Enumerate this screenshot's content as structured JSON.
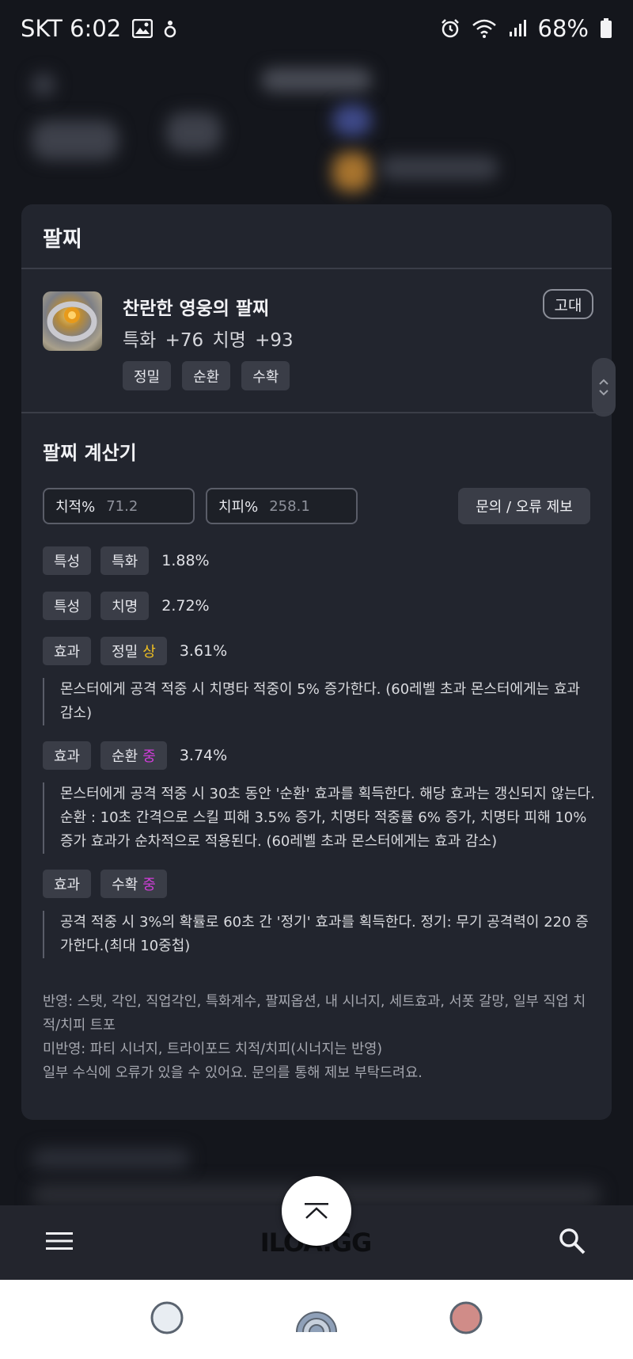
{
  "status_bar": {
    "carrier_time": "SKT 6:02",
    "battery": "68%"
  },
  "card": {
    "section_title": "팔찌",
    "item": {
      "name": "찬란한 영웅의 팔찌",
      "stats": "특화 +76  치명 +93",
      "grade": "고대",
      "chips": [
        "정밀",
        "순환",
        "수확"
      ]
    },
    "calculator": {
      "title": "팔찌 계산기",
      "crit_rate_label": "치적%",
      "crit_rate_value": "71.2",
      "crit_dmg_label": "치피%",
      "crit_dmg_value": "258.1",
      "report_button": "문의 / 오류 제보",
      "rows": [
        {
          "type": "특성",
          "name": "특화",
          "grade": "",
          "value": "1.88%"
        },
        {
          "type": "특성",
          "name": "치명",
          "grade": "",
          "value": "2.72%"
        },
        {
          "type": "효과",
          "name": "정밀",
          "grade": "상",
          "value": "3.61%",
          "desc": "몬스터에게 공격 적중 시 치명타 적중이 5% 증가한다. (60레벨 초과 몬스터에게는 효과 감소)"
        },
        {
          "type": "효과",
          "name": "순환",
          "grade": "중",
          "value": "3.74%",
          "desc": "몬스터에게 공격 적중 시 30초 동안 '순환' 효과를 획득한다. 해당 효과는 갱신되지 않는다. 순환 : 10초 간격으로 스킬 피해 3.5% 증가, 치명타 적중률 6% 증가, 치명타 피해 10% 증가 효과가 순차적으로 적용된다. (60레벨 초과 몬스터에게는 효과 감소)"
        },
        {
          "type": "효과",
          "name": "수확",
          "grade": "중",
          "value": "",
          "desc": "공격 적중 시 3%의 확률로 60초 간 '정기' 효과를 획득한다. 정기: 무기 공격력이 220 증가한다.(최대 10중첩)"
        }
      ],
      "notes": [
        "반영: 스탯, 각인, 직업각인, 특화계수, 팔찌옵션, 내 시너지, 세트효과, 서폿 갈망, 일부 직업 치적/치피 트포",
        "미반영: 파티 시너지, 트라이포드 치적/치피(시너지는 반영)",
        "일부 수식에 오류가 있을 수 있어요. 문의를 통해 제보 부탁드려요."
      ]
    }
  },
  "bottom_nav": {
    "logo": "ILOA.GG",
    "menu_icon": "hamburger-menu-icon",
    "search_icon": "search-icon",
    "fab_icon": "scroll-top-icon"
  },
  "colors": {
    "background": "#14161c",
    "card": "#22252e",
    "tag": "#3a3d47",
    "grade_sang": "#f0c020",
    "grade_jung": "#d23ddb"
  }
}
